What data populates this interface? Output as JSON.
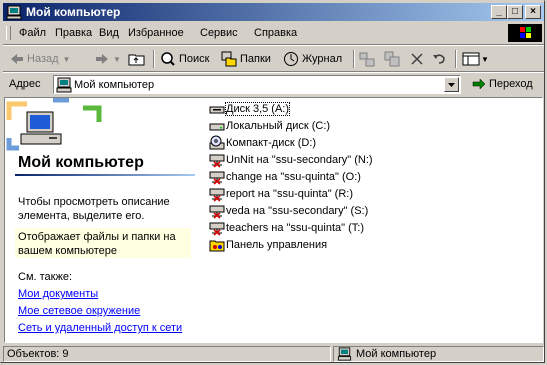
{
  "window": {
    "title": "Мой компьютер"
  },
  "menu": [
    "Файл",
    "Правка",
    "Вид",
    "Избранное",
    "Сервис",
    "Справка"
  ],
  "toolbar": {
    "back": "Назад",
    "search": "Поиск",
    "folders": "Папки",
    "history": "Журнал"
  },
  "address": {
    "label": "Адрес",
    "value": "Мой компьютер",
    "go": "Переход"
  },
  "left_pane": {
    "title": "Мой компьютер",
    "description": "Чтобы просмотреть описание элемента, выделите его.",
    "hint": "Отображает файлы и папки на вашем компьютере",
    "see_also": "См. также:",
    "links": [
      "Мои документы",
      "Мое сетевое окружение",
      "Сеть и удаленный доступ к сети"
    ]
  },
  "items": [
    {
      "label": "Диск 3,5 (A:)",
      "icon": "floppy-drive-icon"
    },
    {
      "label": "Локальный диск (C:)",
      "icon": "hard-drive-icon"
    },
    {
      "label": "Компакт-диск (D:)",
      "icon": "cd-drive-icon"
    },
    {
      "label": "UnNit на \"ssu-secondary\" (N:)",
      "icon": "disconnected-network-drive-icon"
    },
    {
      "label": "change на \"ssu-quinta\" (O:)",
      "icon": "disconnected-network-drive-icon"
    },
    {
      "label": "report на \"ssu-quinta\" (R:)",
      "icon": "disconnected-network-drive-icon"
    },
    {
      "label": "veda на \"ssu-secondary\" (S:)",
      "icon": "disconnected-network-drive-icon"
    },
    {
      "label": "teachers на \"ssu-quinta\" (T:)",
      "icon": "disconnected-network-drive-icon"
    },
    {
      "label": "Панель управления",
      "icon": "control-panel-icon"
    }
  ],
  "status": {
    "count": "Объектов: 9",
    "location": "Мой компьютер"
  },
  "colors": {
    "title_start": "#0a246a",
    "title_end": "#a6caf0",
    "link": "#0000ff",
    "hint_bg": "#ffffe1"
  }
}
